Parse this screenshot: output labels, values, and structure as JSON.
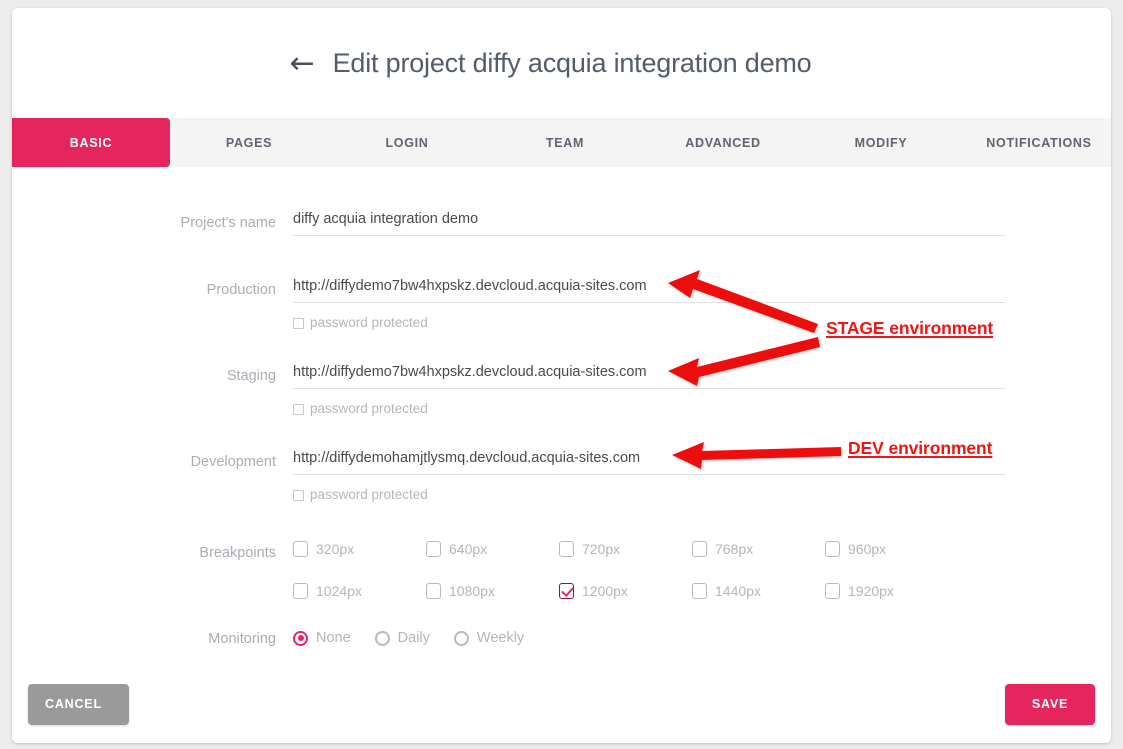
{
  "header": {
    "back_icon": "arrow-left-icon",
    "title": "Edit project diffy acquia integration demo"
  },
  "tabs": [
    {
      "label": "BASIC",
      "active": true
    },
    {
      "label": "PAGES",
      "active": false
    },
    {
      "label": "LOGIN",
      "active": false
    },
    {
      "label": "TEAM",
      "active": false
    },
    {
      "label": "ADVANCED",
      "active": false
    },
    {
      "label": "MODIFY",
      "active": false
    },
    {
      "label": "NOTIFICATIONS",
      "active": false
    }
  ],
  "form": {
    "project_name": {
      "label": "Project's name",
      "value": "diffy acquia integration demo"
    },
    "production": {
      "label": "Production",
      "value": "http://diffydemo7bw4hxpskz.devcloud.acquia-sites.com",
      "password_protected_label": "password protected",
      "password_protected_checked": false
    },
    "staging": {
      "label": "Staging",
      "value": "http://diffydemo7bw4hxpskz.devcloud.acquia-sites.com",
      "password_protected_label": "password protected",
      "password_protected_checked": false
    },
    "development": {
      "label": "Development",
      "value": "http://diffydemohamjtlysmq.devcloud.acquia-sites.com",
      "password_protected_label": "password protected",
      "password_protected_checked": false
    },
    "breakpoints": {
      "label": "Breakpoints",
      "options": [
        {
          "label": "320px",
          "checked": false
        },
        {
          "label": "640px",
          "checked": false
        },
        {
          "label": "720px",
          "checked": false
        },
        {
          "label": "768px",
          "checked": false
        },
        {
          "label": "960px",
          "checked": false
        },
        {
          "label": "1024px",
          "checked": false
        },
        {
          "label": "1080px",
          "checked": false
        },
        {
          "label": "1200px",
          "checked": true
        },
        {
          "label": "1440px",
          "checked": false
        },
        {
          "label": "1920px",
          "checked": false
        }
      ]
    },
    "monitoring": {
      "label": "Monitoring",
      "options": [
        {
          "label": "None",
          "selected": true
        },
        {
          "label": "Daily",
          "selected": false
        },
        {
          "label": "Weekly",
          "selected": false
        }
      ]
    }
  },
  "footer": {
    "cancel_label": "CANCEL",
    "save_label": "SAVE"
  },
  "annotations": [
    {
      "text": "STAGE environment",
      "color": "#f01414"
    },
    {
      "text": "DEV environment",
      "color": "#f01414"
    }
  ],
  "colors": {
    "accent_pink": "#e5265e",
    "annotation_red": "#f01414",
    "cancel_gray": "#9a9a9a",
    "page_bg": "#ececec",
    "tabbar_bg": "#f4f4f4"
  }
}
